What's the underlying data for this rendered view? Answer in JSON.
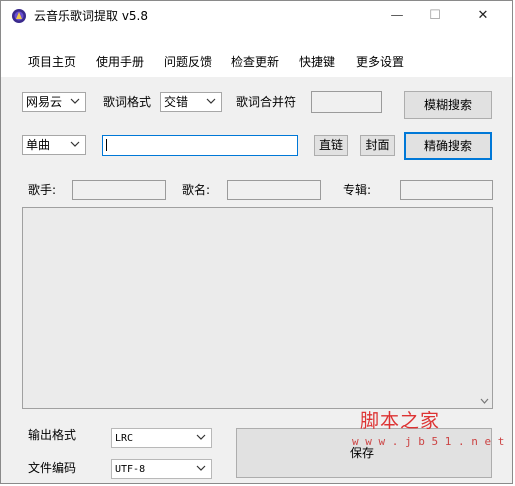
{
  "window": {
    "title": "云音乐歌词提取 v5.8",
    "minimize_glyph": "—",
    "maximize_glyph": "☐",
    "close_glyph": "✕"
  },
  "menu": [
    "项目主页",
    "使用手册",
    "问题反馈",
    "检查更新",
    "快捷键",
    "更多设置"
  ],
  "search": {
    "source_selected": "网易云",
    "lyric_format_label": "歌词格式",
    "lyric_format_selected": "交错",
    "merge_symbol_label": "歌词合并符",
    "merge_symbol_value": "",
    "fuzzy_search_label": "模糊搜索",
    "mode_selected": "单曲",
    "query_value": "",
    "direct_link_label": "直链",
    "cover_label": "封面",
    "exact_search_label": "精确搜索"
  },
  "info": {
    "singer_label": "歌手:",
    "singer_value": "",
    "song_label": "歌名:",
    "song_value": "",
    "album_label": "专辑:",
    "album_value": ""
  },
  "output": {
    "format_label": "输出格式",
    "format_selected": "LRC",
    "encoding_label": "文件编码",
    "encoding_selected": "UTF-8",
    "save_label": "保存"
  },
  "watermark": {
    "brand": "脚本之家",
    "url": "w w w . j b 5 1 . n e t"
  },
  "colors": {
    "accent": "#0078d7",
    "watermark": "#d33333"
  }
}
